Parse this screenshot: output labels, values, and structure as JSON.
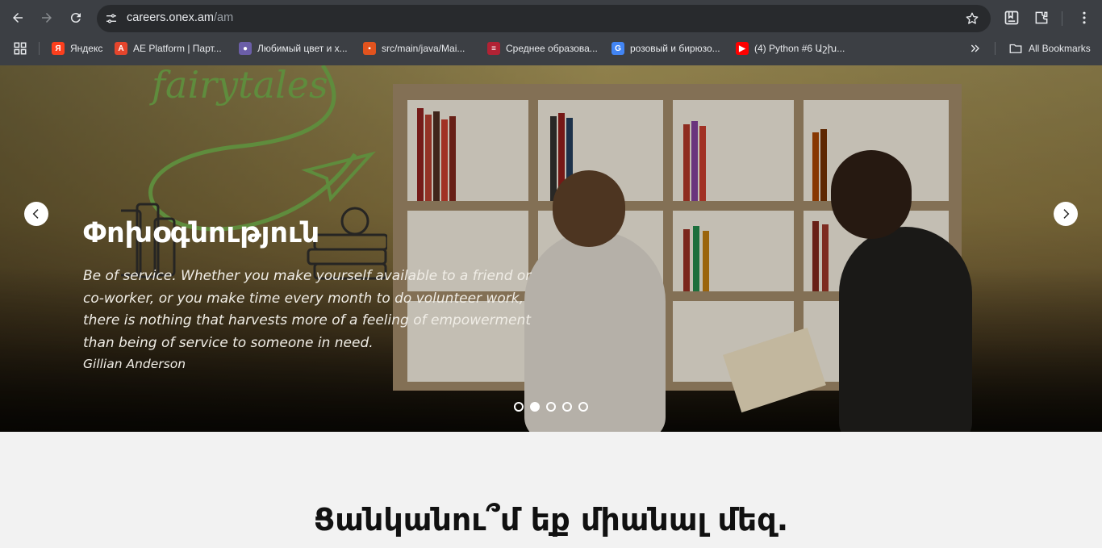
{
  "browser": {
    "url_host": "careers.onex.am",
    "url_path": "/am",
    "bookmarks": [
      {
        "label": "Яндекс",
        "icon": "yandex-icon",
        "color": "#fc3f1d",
        "glyph": "Я"
      },
      {
        "label": "AE Platform | Парт...",
        "icon": "ae-platform-icon",
        "color": "#e5452c",
        "glyph": "A"
      },
      {
        "label": "Любимый цвет и х...",
        "icon": "person-icon",
        "color": "#6b5ea8",
        "glyph": "●"
      },
      {
        "label": "src/main/java/Mai...",
        "icon": "gitlab-icon",
        "color": "#e2531e",
        "glyph": "▪"
      },
      {
        "label": "Среднее образова...",
        "icon": "flag-icon",
        "color": "#b22234",
        "glyph": "≡"
      },
      {
        "label": "розовый и бирюзо...",
        "icon": "google-icon",
        "color": "#4285f4",
        "glyph": "G"
      },
      {
        "label": "(4) Python #6 Աշխ...",
        "icon": "youtube-icon",
        "color": "#ff0000",
        "glyph": "▶"
      }
    ],
    "all_bookmarks": "All Bookmarks"
  },
  "hero": {
    "title": "Փոխօգնություն",
    "quote": "Be of service. Whether you make yourself available to a friend or co-worker, or you make time every month to do volunteer work, there is nothing that harvests more of a feeling of empowerment than being of service to someone in need.",
    "author": "Gillian Anderson",
    "slides_total": 5,
    "active_slide": 2
  },
  "section": {
    "heading": "Ցանկանու՞մ եք միանալ մեզ."
  }
}
